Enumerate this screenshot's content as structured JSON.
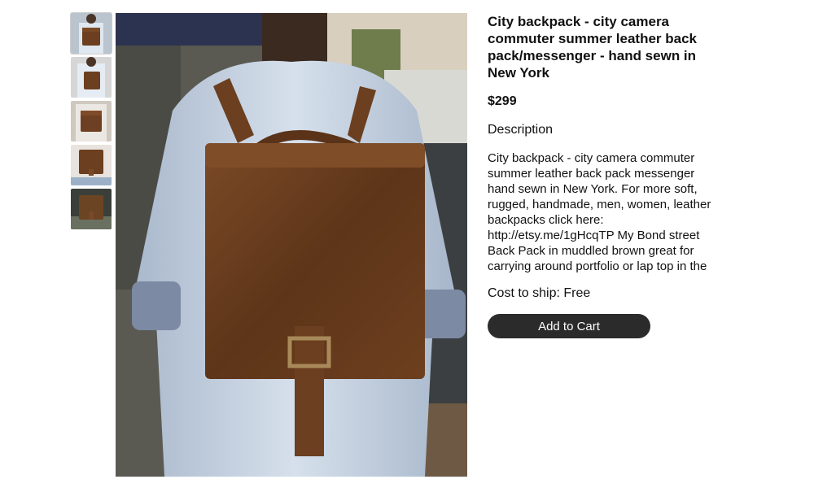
{
  "gallery": {
    "thumbnails": [
      {
        "alt": "thumbnail 1",
        "selected": true
      },
      {
        "alt": "thumbnail 2",
        "selected": false
      },
      {
        "alt": "thumbnail 3",
        "selected": false
      },
      {
        "alt": "thumbnail 4",
        "selected": false
      },
      {
        "alt": "thumbnail 5",
        "selected": false
      }
    ]
  },
  "product": {
    "title": "City backpack - city camera commuter summer leather back pack/messenger - hand sewn in New York",
    "price": "$299",
    "description_heading": "Description",
    "description": "City backpack - city camera commuter summer leather back pack messenger hand sewn in New York. For more soft, rugged, handmade, men, women, leather backpacks click here: http://etsy.me/1gHcqTP My Bond street Back Pack in muddled brown great for carrying around portfolio or lap top in the city, or commuting to",
    "shipping": "Cost to ship: Free",
    "add_to_cart_label": "Add to Cart"
  },
  "colors": {
    "leather": "#6b3f1f",
    "shirt": "#c9d6e8",
    "button_bg": "#2b2b2b"
  }
}
